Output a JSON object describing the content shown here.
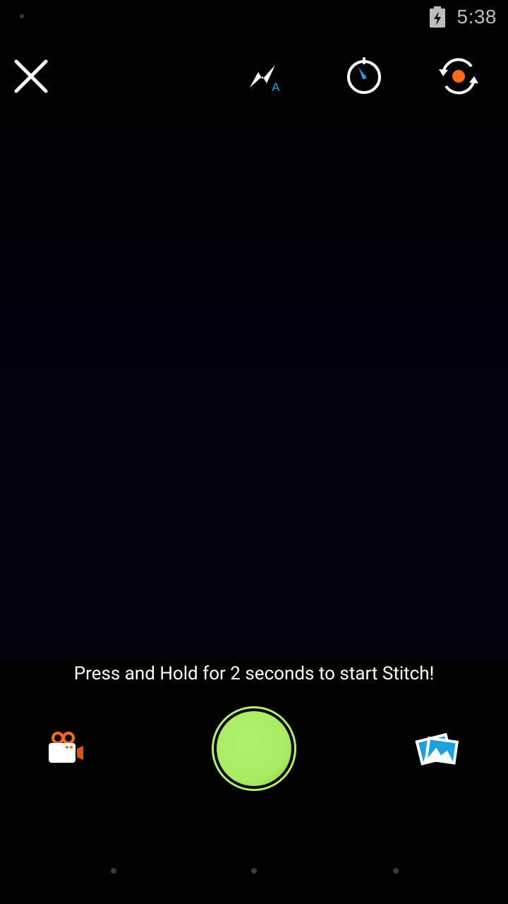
{
  "status_bar": {
    "time": "5:38",
    "battery_icon": "battery-charging-icon"
  },
  "toolbar": {
    "close_icon": "close-icon",
    "flash_icon": "flash-auto-icon",
    "flash_mode_label": "A",
    "timer_icon": "timer-icon",
    "flip_icon": "switch-camera-icon"
  },
  "hint": {
    "text": "Press and Hold for 2 seconds to start Stitch!"
  },
  "controls": {
    "video_icon": "video-camera-icon",
    "capture_icon": "shutter-icon",
    "gallery_icon": "gallery-photos-icon"
  },
  "colors": {
    "accent_green": "#a9ec64",
    "ring_green": "#b7ef6f",
    "accent_blue": "#1ea0e0",
    "accent_orange": "#ff6a1a"
  }
}
